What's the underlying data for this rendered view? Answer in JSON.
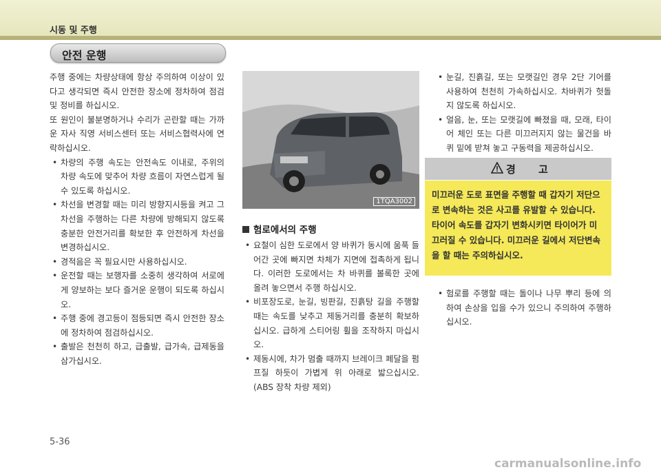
{
  "header": {
    "section": "시동 및 주행"
  },
  "section_title": "안전 운행",
  "left_col": {
    "intro": [
      "주행 중에는 차량상태에 항상 주의하여 이상이 있다고 생각되면 즉시 안전한 장소에 정차하여 점검 및 정비를 하십시오.",
      "또 원인이 불분명하거나 수리가 곤란할 때는 가까운 자사 직영 서비스센터 또는 서비스협력사에 연락하십시오."
    ],
    "bullets": [
      "차량의 주행 속도는 안전속도 이내로, 주위의 차량 속도에 맞추어 차량 흐름이 자연스럽게 될 수 있도록 하십시오.",
      "차선을 변경할 때는 미리 방향지시등을 켜고 그 차선을 주행하는 다른 차량에 방해되지 않도록 충분한 안전거리를 확보한 후 안전하게 차선을 변경하십시오.",
      "경적음은 꼭 필요시만 사용하십시오.",
      "운전할 때는 보행자를 소중히 생각하여 서로에게 양보하는 보다 즐거운 운행이 되도록 하십시오.",
      "주행 중에 경고등이 점등되면 즉시 안전한 장소에 정차하여 점검하십시오.",
      "출발은 천천히 하고, 급출발, 급가속, 급제동을 삼가십시오."
    ]
  },
  "photo": {
    "code": "1TQA3002"
  },
  "mid_col": {
    "heading": "험로에서의 주행",
    "bullets": [
      "요철이 심한 도로에서 양 바퀴가 동시에 움푹 들어간 곳에 빠지면 차체가 지면에 접촉하게 됩니다. 이러한 도로에서는 차 바퀴를 볼록한 곳에 올려 놓으면서 주행 하십시오.",
      "비포장도로, 눈길, 빙판길, 진흙탕 길을 주행할 때는 속도를 낮추고 제동거리를 충분히 확보하십시오. 급하게 스티어링 휠을 조작하지 마십시오.",
      "제동시에, 차가 멈출 때까지 브레이크 페달을 펌프질 하듯이 가볍게 위 아래로 밟으십시오. (ABS 장착 차량 제외)"
    ]
  },
  "right_col": {
    "bullets_top": [
      "눈길, 진흙길, 또는 모랫길인 경우 2단 기어를 사용하여 천천히 가속하십시오. 차바퀴가 헛돌지 않도록 하십시오.",
      "얼음, 눈, 또는 모랫길에 빠졌을 때, 모래, 타이어 체인 또는 다른 미끄러지지 않는 물건을 바퀴 밑에 받쳐 놓고 구동력을 제공하십시오."
    ],
    "warning_title": "경 고",
    "warning_text": "미끄러운 도로 표면을 주행할 때 갑자기 저단으로 변속하는 것은 사고를 유발할 수 있습니다. 타이어 속도를 갑자기 변화시키면 타이어가 미끄러질 수 있습니다. 미끄러운 길에서 저단변속을 할 때는 주의하십시오.",
    "bullets_bottom": [
      "험로를 주행할 때는 돌이나 나무 뿌리 등에 의하여 손상을 입을 수가 있으니 주의하여 주행하십시오."
    ]
  },
  "page_number": "5-36",
  "watermark": "carmanualsonline.info",
  "colors": {
    "header_bg": "#e9e9c6",
    "header_rule": "#b5b37a",
    "warning_bg": "#f5e95a",
    "warning_head": "#c9c9c9"
  }
}
